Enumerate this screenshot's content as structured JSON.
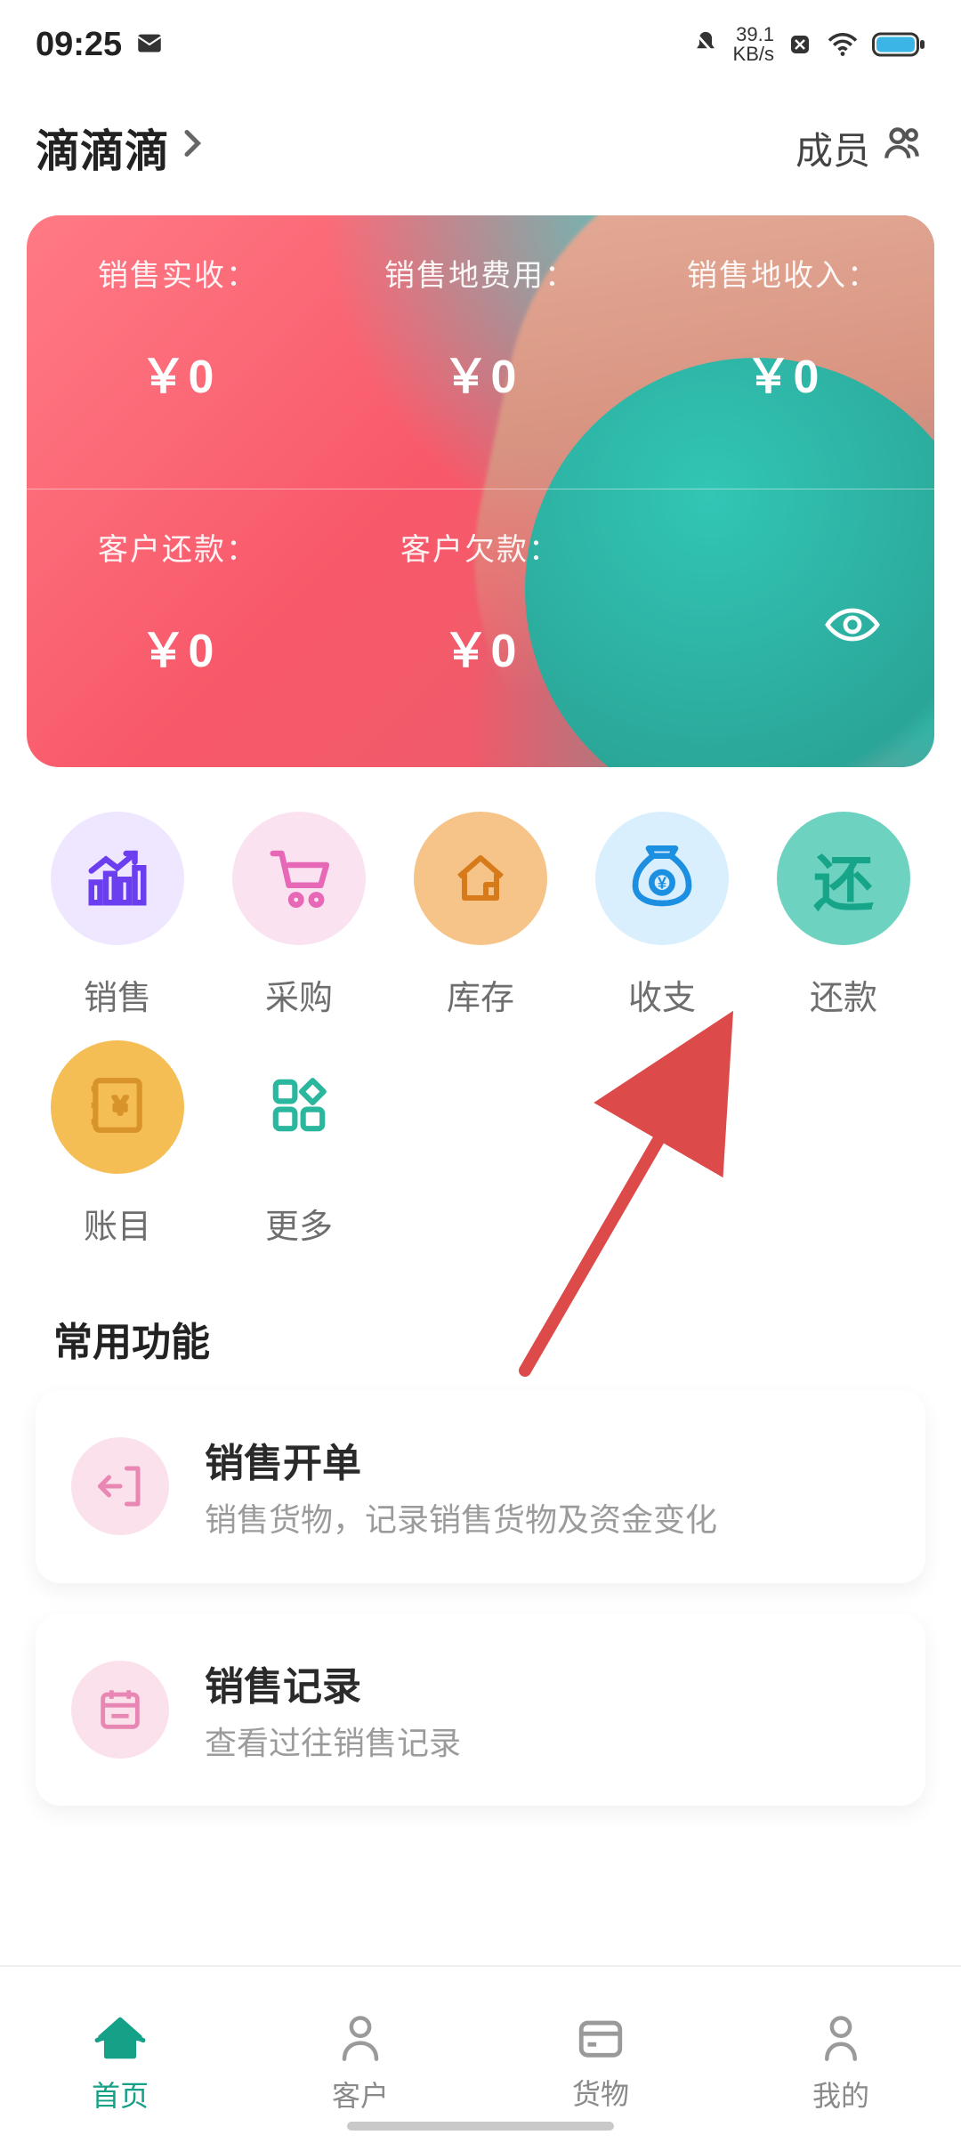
{
  "status": {
    "time": "09:25",
    "net_speed_top": "39.1",
    "net_speed_unit": "KB/s"
  },
  "header": {
    "title": "滴滴滴",
    "members_label": "成员"
  },
  "summary": {
    "top": [
      {
        "label": "销售实收：",
        "value": "￥0"
      },
      {
        "label": "销售地费用：",
        "value": "￥0"
      },
      {
        "label": "销售地收入：",
        "value": "￥0"
      }
    ],
    "bottom": [
      {
        "label": "客户还款：",
        "value": "￥0"
      },
      {
        "label": "客户欠款：",
        "value": "￥0"
      }
    ]
  },
  "actions": [
    {
      "id": "sales",
      "label": "销售",
      "circle": "c-sales",
      "icon": "chart-up-icon",
      "color": "#6b3ff0"
    },
    {
      "id": "purchase",
      "label": "采购",
      "circle": "c-purchase",
      "icon": "cart-icon",
      "color": "#e668b7"
    },
    {
      "id": "stock",
      "label": "库存",
      "circle": "c-stock",
      "icon": "house-icon",
      "color": "#d67a1a"
    },
    {
      "id": "finance",
      "label": "收支",
      "circle": "c-finance",
      "icon": "money-bag-icon",
      "color": "#1d8fe1"
    },
    {
      "id": "repay",
      "label": "还款",
      "circle": "c-repay",
      "icon": "text-glyph",
      "glyph": "还",
      "color": "#17a589"
    },
    {
      "id": "ledger",
      "label": "账目",
      "circle": "c-ledger",
      "icon": "ledger-icon",
      "color": "#d9932b"
    },
    {
      "id": "more",
      "label": "更多",
      "circle": "c-more",
      "icon": "grid-icon",
      "color": "#2ab79e"
    }
  ],
  "section": {
    "title": "常用功能"
  },
  "cards": [
    {
      "id": "open-sale",
      "title": "销售开单",
      "subtitle": "销售货物，记录销售货物及资金变化",
      "icon": "exit-left-icon"
    },
    {
      "id": "sale-record",
      "title": "销售记录",
      "subtitle": "查看过往销售记录",
      "icon": "calendar-icon"
    }
  ],
  "nav": [
    {
      "id": "home",
      "label": "首页",
      "active": true
    },
    {
      "id": "customer",
      "label": "客户",
      "active": false
    },
    {
      "id": "goods",
      "label": "货物",
      "active": false
    },
    {
      "id": "mine",
      "label": "我的",
      "active": false
    }
  ]
}
